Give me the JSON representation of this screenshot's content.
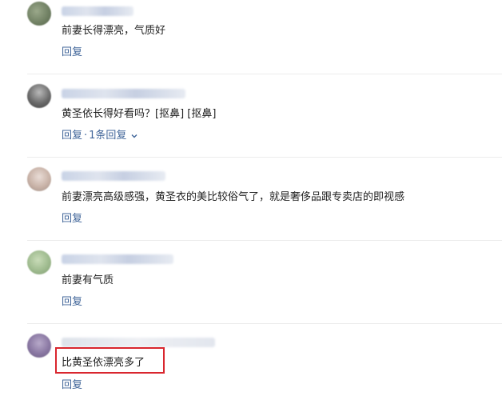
{
  "comments": [
    {
      "text": "前妻长得漂亮，气质好",
      "reply_label": "回复"
    },
    {
      "text": "黄圣依长得好看吗？[抠鼻] [抠鼻]",
      "reply_label": "回复",
      "reply_count_label": "1条回复"
    },
    {
      "text": "前妻漂亮高级感强，黄圣衣的美比较俗气了，就是奢侈品跟专卖店的即视感",
      "reply_label": "回复"
    },
    {
      "text": "前妻有气质",
      "reply_label": "回复"
    },
    {
      "text": "比黄圣依漂亮多了",
      "reply_label": "回复"
    }
  ],
  "separator": "·",
  "colors": {
    "link": "#406599",
    "highlight": "#d9262e",
    "divider": "#ececec"
  }
}
